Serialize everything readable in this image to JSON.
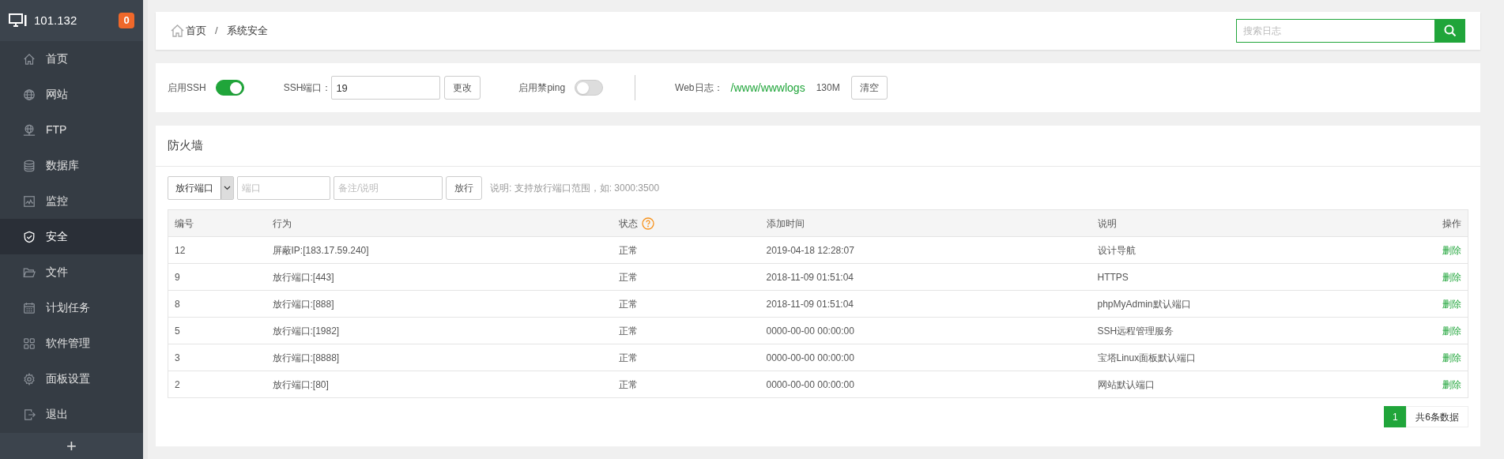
{
  "sidebar": {
    "host": "101.132",
    "badge": "0",
    "items": [
      {
        "label": "首页",
        "selected": false
      },
      {
        "label": "网站",
        "selected": false
      },
      {
        "label": "FTP",
        "selected": false
      },
      {
        "label": "数据库",
        "selected": false
      },
      {
        "label": "监控",
        "selected": false
      },
      {
        "label": "安全",
        "selected": true
      },
      {
        "label": "文件",
        "selected": false
      },
      {
        "label": "计划任务",
        "selected": false
      },
      {
        "label": "软件管理",
        "selected": false
      },
      {
        "label": "面板设置",
        "selected": false
      },
      {
        "label": "退出",
        "selected": false
      }
    ],
    "add": "+"
  },
  "breadcrumb": [
    "首页",
    "系统安全"
  ],
  "breadcrumb_separator": "/",
  "search": {
    "placeholder": "搜索日志"
  },
  "settings": {
    "ssh_label": "启用SSH",
    "ssh_on": true,
    "port_label": "SSH端口：",
    "port_value": "19",
    "change_button": "更改",
    "ping_label": "启用禁ping",
    "ping_on": false,
    "weblog_label": "Web日志：",
    "weblog_path": "/www/wwwlogs",
    "weblog_size": "130M",
    "clear_button": "清空"
  },
  "firewall": {
    "title": "防火墙",
    "select": "放行端口",
    "port_placeholder": "端口",
    "note_placeholder": "备注/说明",
    "allow_button": "放行",
    "hint": "说明: 支持放行端口范围，如: 3000:3500",
    "table": {
      "columns": [
        "编号",
        "行为",
        "状态",
        "添加时间",
        "说明",
        "操作"
      ],
      "rows": [
        [
          "12",
          "屏蔽IP:[183.17.59.240]",
          "正常",
          "2019-04-18 12:28:07",
          "设计导航",
          "删除"
        ],
        [
          "9",
          "放行端口:[443]",
          "正常",
          "2018-11-09 01:51:04",
          "HTTPS",
          "删除"
        ],
        [
          "8",
          "放行端口:[888]",
          "正常",
          "2018-11-09 01:51:04",
          "phpMyAdmin默认端口",
          "删除"
        ],
        [
          "5",
          "放行端口:[1982]",
          "正常",
          "0000-00-00 00:00:00",
          "SSH远程管理服务",
          "删除"
        ],
        [
          "3",
          "放行端口:[8888]",
          "正常",
          "0000-00-00 00:00:00",
          "宝塔Linux面板默认端口",
          "删除"
        ],
        [
          "2",
          "放行端口:[80]",
          "正常",
          "0000-00-00 00:00:00",
          "网站默认端口",
          "删除"
        ]
      ]
    },
    "pagination": {
      "pages": [
        {
          "label": "1",
          "selected": true
        }
      ],
      "total": "共6条数据"
    }
  }
}
